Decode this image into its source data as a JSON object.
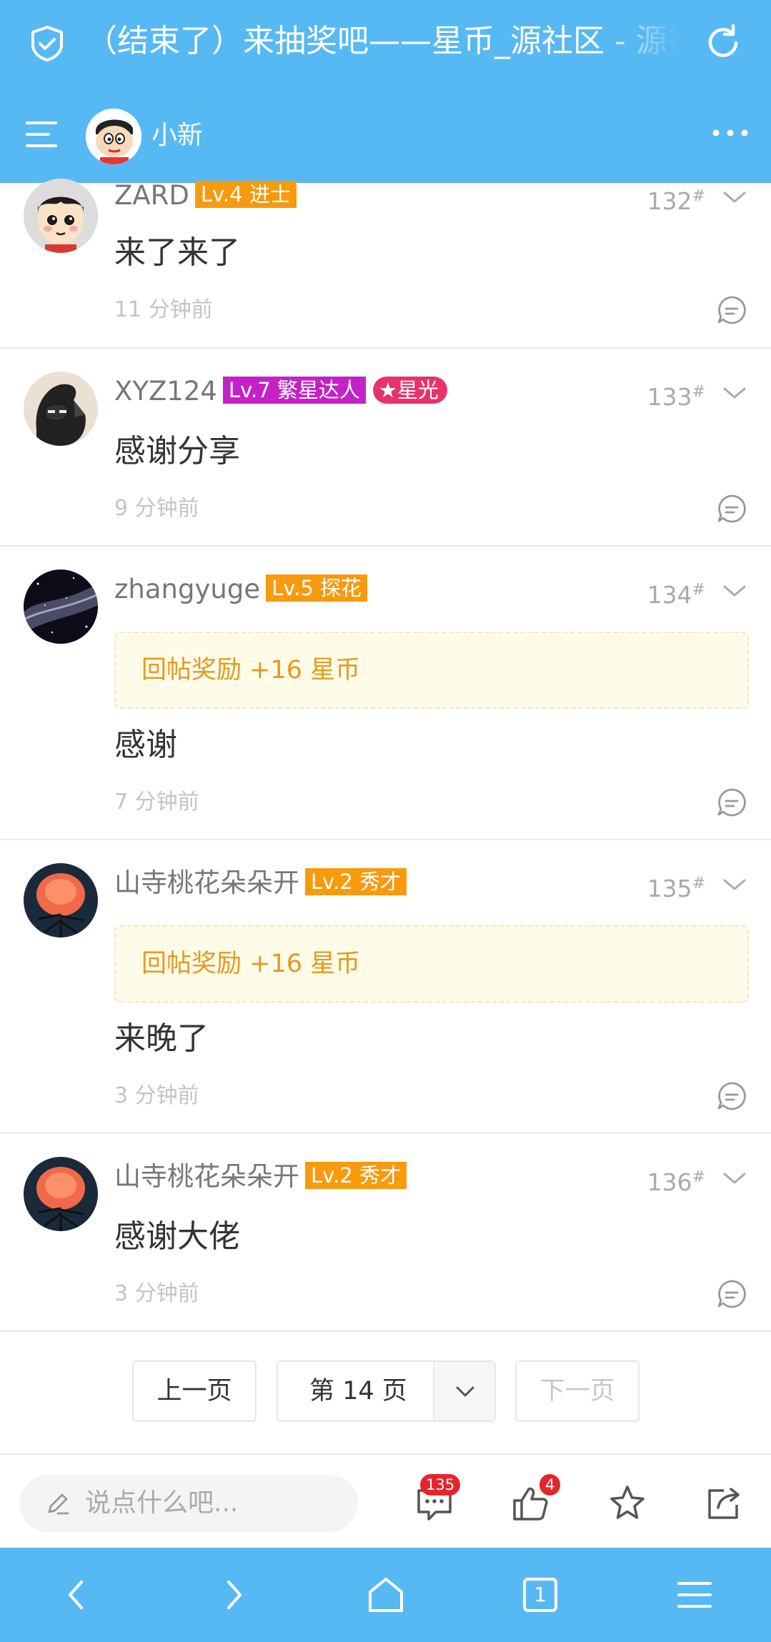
{
  "browser": {
    "title": "（结束了）来抽奖吧——星币_源社区 - 源社区",
    "tab_count": "1"
  },
  "header": {
    "user_name": "小新"
  },
  "posts": [
    {
      "user": "ZARD",
      "level": "Lv.4 进士",
      "floor": "132",
      "content": "来了来了",
      "time": "11 分钟前"
    },
    {
      "user": "XYZ124",
      "level": "Lv.7 繁星达人",
      "special_badge": "★星光",
      "floor": "133",
      "content": "感谢分享",
      "time": "9 分钟前"
    },
    {
      "user": "zhangyuge",
      "level": "Lv.5 探花",
      "floor": "134",
      "reward": "回帖奖励 +16 星币",
      "content": "感谢",
      "time": "7 分钟前"
    },
    {
      "user": "山寺桃花朵朵开",
      "level": "Lv.2 秀才",
      "floor": "135",
      "reward": "回帖奖励 +16 星币",
      "content": "来晚了",
      "time": "3 分钟前"
    },
    {
      "user": "山寺桃花朵朵开",
      "level": "Lv.2 秀才",
      "floor": "136",
      "content": "感谢大佬",
      "time": "3 分钟前"
    }
  ],
  "floor_suffix": "#",
  "pagination": {
    "prev": "上一页",
    "current": "第 14 页",
    "next": "下一页"
  },
  "comment_bar": {
    "placeholder": "说点什么吧...",
    "comment_count": "135",
    "like_count": "4"
  },
  "colors": {
    "primary": "#57b9f3",
    "level_badge": "#f79a0d",
    "level7_badge": "#c422c6",
    "star_badge": "#e8336a",
    "reward_text": "#e49a1e",
    "count_badge": "#e3262b"
  },
  "icons": [
    "shield-check-icon",
    "reload-icon",
    "menu-icon",
    "more-icon",
    "chevron-down-icon",
    "reply-icon",
    "pencil-icon",
    "comment-icon",
    "thumb-up-icon",
    "star-icon",
    "share-icon",
    "back-icon",
    "forward-icon",
    "home-icon",
    "tabs-icon",
    "browser-menu-icon"
  ]
}
